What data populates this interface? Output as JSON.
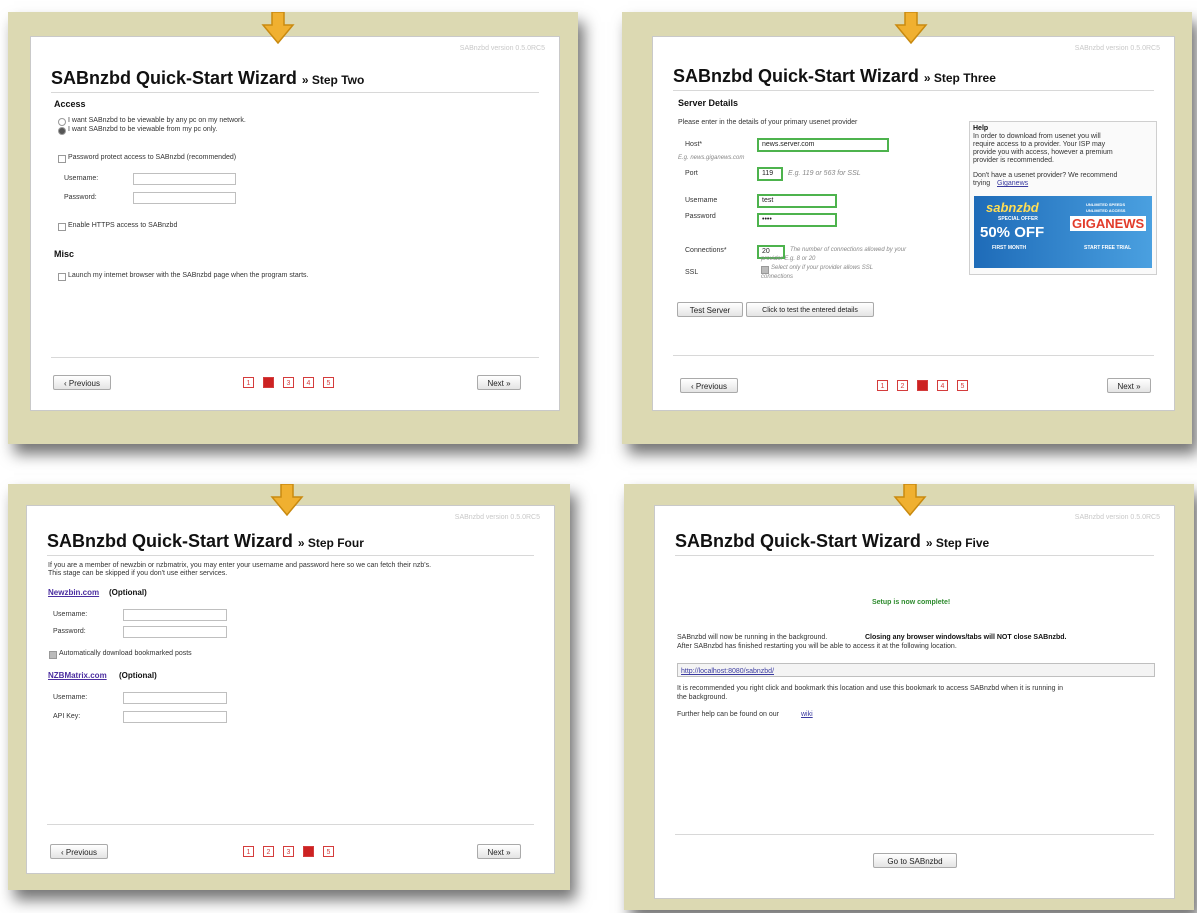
{
  "version_text": "SABnzbd version 0.5.0RC5",
  "wizard_title": "SABnzbd Quick-Start Wizard",
  "previous_label": "‹ Previous",
  "next_label": "Next »",
  "arrow_icon": "down-arrow-icon",
  "colors": {
    "frame": "#dcd9b2",
    "page_active": "#cc2222",
    "page_border": "#d43c3c",
    "input_green": "#4db34d",
    "link": "#3a3aa0"
  },
  "pages": [
    "1",
    "2",
    "3",
    "4",
    "5"
  ],
  "step2": {
    "step_label": "» Step Two",
    "access_heading": "Access",
    "radio_network": "I want SABnzbd to be viewable by any pc on my network.",
    "radio_local": "I want SABnzbd to be viewable from my pc only.",
    "password_protect": "Password protect access to SABnzbd (recommended)",
    "username_label": "Username:",
    "password_label": "Password:",
    "https_label": "Enable HTTPS access to SABnzbd",
    "misc_heading": "Misc",
    "launch_browser": "Launch my internet browser with the SABnzbd page when the program starts.",
    "current_page": "2"
  },
  "step3": {
    "step_label": "» Step Three",
    "heading": "Server Details",
    "intro": "Please enter in the details of your primary usenet provider",
    "host_label": "Host*",
    "host_value": "news.server.com",
    "host_hint": "E.g. news.giganews.com",
    "port_label": "Port",
    "port_value": "119",
    "port_hint": "E.g. 119 or 563 for SSL",
    "username_label": "Username",
    "username_value": "test",
    "password_label": "Password",
    "password_value": "••••",
    "connections_label": "Connections*",
    "connections_value": "20",
    "connections_hint_1": "The number of connections allowed by your",
    "connections_hint_2": "provider E.g. 8 or 20",
    "ssl_label": "SSL",
    "ssl_hint_1": "Select only if your provider allows SSL",
    "ssl_hint_2": "connections",
    "test_server_button": "Test Server",
    "test_server_hint": "Click to test the entered details",
    "help_title": "Help",
    "help_line1": "In order to download from usenet you will",
    "help_line2": "require access to a provider. Your ISP may",
    "help_line3": "provide you with access, however a premium",
    "help_line4": "provider is recommended.",
    "help_line5": "Don't have a usenet provider? We recommend",
    "help_line6": "trying",
    "help_link": "Giganews",
    "banner_brand": "sabnzbd",
    "banner_special": "SPECIAL OFFER",
    "banner_offer": "50% OFF",
    "banner_month": "FIRST MONTH",
    "banner_tag1": "UNLIMITED SPEEDS",
    "banner_tag2": "UNLIMITED ACCESS",
    "banner_giganews": "GIGANEWS",
    "banner_trial": "START FREE TRIAL",
    "current_page": "3"
  },
  "step4": {
    "step_label": "» Step Four",
    "intro_line1": "If you are a member of newzbin or nzbmatrix, you may enter your username and password here so we can fetch their nzb's.",
    "intro_line2": "This stage can be skipped if you don't use either services.",
    "newzbin_link": "Newzbin.com",
    "optional": "(Optional)",
    "username_label": "Username:",
    "password_label": "Password:",
    "auto_download": "Automatically download bookmarked posts",
    "nzbmatrix_link": "NZBMatrix.com",
    "apikey_label": "API Key:",
    "current_page": "4"
  },
  "step5": {
    "step_label": "» Step Five",
    "complete": "Setup is now complete!",
    "running_text": "SABnzbd will now be running in the background.",
    "closing_text": "Closing any browser windows/tabs will NOT close SABnzbd.",
    "after_text": "After SABnzbd has finished restarting you will be able to access it at the following location.",
    "url": "http://localhost:8080/sabnzbd/",
    "bookmark_line1": "It is recommended you right click and bookmark this location and use this bookmark to access SABnzbd when it is running in",
    "bookmark_line2": "the background.",
    "further_help": "Further help can be found on our",
    "wiki_link": "wiki",
    "go_button": "Go to SABnzbd"
  }
}
